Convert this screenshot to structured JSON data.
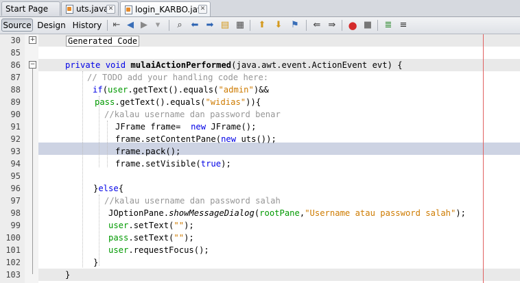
{
  "tabs": [
    {
      "label": "Start Page"
    },
    {
      "label": "uts.java"
    },
    {
      "label": "login_KARBO.java"
    }
  ],
  "toolbar": {
    "source": "Source",
    "design": "Design",
    "history": "History"
  },
  "editor": {
    "collapsed_label": "Generated Code",
    "lines": [
      {
        "n": "30"
      },
      {
        "n": "85"
      },
      {
        "n": "86"
      },
      {
        "n": "87"
      },
      {
        "n": "88"
      },
      {
        "n": "89"
      },
      {
        "n": "90"
      },
      {
        "n": "91"
      },
      {
        "n": "92"
      },
      {
        "n": "93"
      },
      {
        "n": "94"
      },
      {
        "n": "95"
      },
      {
        "n": "96"
      },
      {
        "n": "97"
      },
      {
        "n": "98"
      },
      {
        "n": "99"
      },
      {
        "n": "100"
      },
      {
        "n": "101"
      },
      {
        "n": "102"
      },
      {
        "n": "103"
      }
    ],
    "code": {
      "l86a": "private void ",
      "l86b": "mulaiActionPerformed",
      "l86c": "(java.awt.event.ActionEvent evt) {",
      "l87": "// TODO add your handling code here:",
      "l88a": "if",
      "l88b": "(",
      "l88c": "user",
      "l88d": ".getText().equals(",
      "l88e": "\"admin\"",
      "l88f": ")&&",
      "l89a": "pass",
      "l89b": ".getText().equals(",
      "l89c": "\"widias\"",
      "l89d": ")){",
      "l90": "//kalau username dan password benar",
      "l91a": "JFrame frame=  ",
      "l91b": "new",
      "l91c": " JFrame();",
      "l92a": "frame.setContentPane(",
      "l92b": "new",
      "l92c": " uts());",
      "l93": "frame.pack();",
      "l94a": "frame.setVisible(",
      "l94b": "true",
      "l94c": ");",
      "l96a": "}",
      "l96b": "else",
      "l96c": "{",
      "l97": "//kalau username dan password salah",
      "l98a": "JOptionPane.",
      "l98b": "showMessageDialog",
      "l98c": "(",
      "l98d": "rootPane",
      "l98e": ",",
      "l98f": "\"Username atau password salah\"",
      "l98g": ");",
      "l99a": "user",
      "l99b": ".setText(",
      "l99c": "\"\"",
      "l99d": ");",
      "l100a": "pass",
      "l100b": ".setText(",
      "l100c": "\"\"",
      "l100d": ");",
      "l101a": "user",
      "l101b": ".requestFocus();",
      "l102": "}",
      "l103": "}"
    }
  },
  "icons": {
    "back": "back-icon",
    "forward": "forward-icon"
  }
}
